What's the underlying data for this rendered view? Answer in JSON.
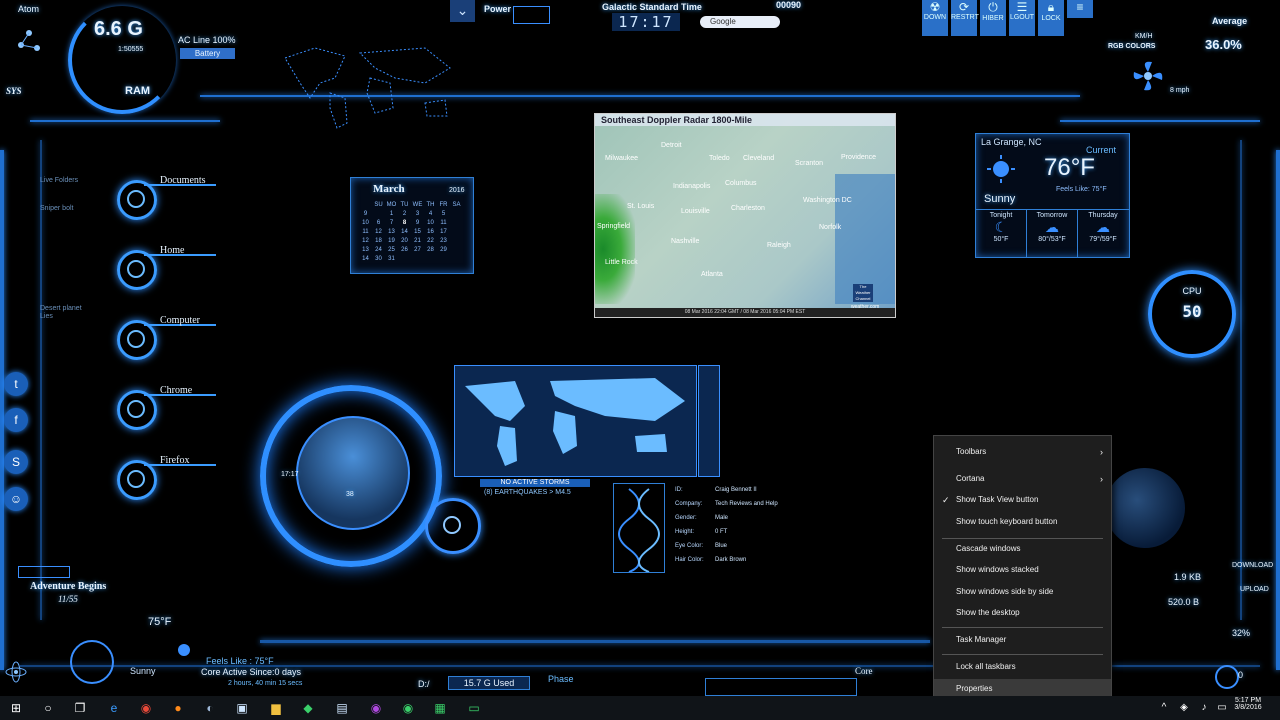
{
  "top_left": {
    "atom_label": "Atom",
    "ram_value": "6.6 G",
    "ram_sub": "1:50555",
    "ram_label": "RAM",
    "ac_line": "AC Line 100%",
    "battery": "Battery",
    "sys_label": "SYS"
  },
  "top_center": {
    "power_label": "Power",
    "clock_title": "Galactic Standard Time",
    "clock_value": "17:17",
    "search_label": "Google",
    "counter": "00090"
  },
  "top_buttons": [
    "DOWN",
    "RESTRT",
    "HIBER",
    "LGOUT",
    "LOCK"
  ],
  "top_right": {
    "average_label": "Average",
    "average_value": "36.0%",
    "kmh": "KM/H",
    "rgb": "RGB COLORS",
    "speed": "8 mph"
  },
  "shortcuts": [
    {
      "label": "Documents"
    },
    {
      "label": "Home"
    },
    {
      "label": "Computer"
    },
    {
      "label": "Chrome"
    },
    {
      "label": "Firefox"
    }
  ],
  "left_notes": [
    "Live Folders",
    "Sniper bolt",
    "Desert planet",
    "Lies"
  ],
  "calendar": {
    "month": "March",
    "year": "2016",
    "days": [
      "SU",
      "MO",
      "TU",
      "WE",
      "TH",
      "FR",
      "SA"
    ],
    "weeks": [
      [
        "9",
        "",
        "1",
        "2",
        "3",
        "4",
        "5"
      ],
      [
        "10",
        "6",
        "7",
        "8",
        "9",
        "10",
        "11"
      ],
      [
        "11",
        "12",
        "13",
        "14",
        "15",
        "16",
        "17"
      ],
      [
        "12",
        "18",
        "19",
        "20",
        "21",
        "22",
        "23"
      ],
      [
        "13",
        "24",
        "25",
        "26",
        "27",
        "28",
        "29"
      ],
      [
        "14",
        "30",
        "31",
        "",
        "",
        "",
        ""
      ]
    ]
  },
  "radar": {
    "title": "Southeast Doppler Radar  1800-Mile",
    "cities": [
      "Milwaukee",
      "Detroit",
      "Toledo",
      "Cleveland",
      "Scranton",
      "Providence",
      "Indianapolis",
      "Columbus",
      "St. Louis",
      "Louisville",
      "Charleston",
      "Washington DC",
      "Springfield",
      "Nashville",
      "Raleigh",
      "Norfolk",
      "Little Rock",
      "Atlanta"
    ],
    "footer": "08 Mar 2016 22:04 GMT / 08 Mar 2016 05:04 PM EST",
    "brand": "The Weather Channel",
    "brand_site": "weather.com"
  },
  "weather": {
    "location": "La Grange, NC",
    "current_label": "Current",
    "temp": "76°F",
    "feels": "Feels Like: 75°F",
    "condition": "Sunny",
    "forecast": [
      {
        "day": "Tonight",
        "temp": "50°F"
      },
      {
        "day": "Tomorrow",
        "temp": "80°/53°F"
      },
      {
        "day": "Thursday",
        "temp": "79°/59°F"
      }
    ]
  },
  "cpu": {
    "label": "CPU",
    "value": "50"
  },
  "hud": {
    "time": "17:17",
    "number": "38"
  },
  "world_map": {
    "storms": "NO ACTIVE STORMS",
    "quakes": "(8) EARTHQUAKES > M4.5"
  },
  "profile": {
    "rows": [
      {
        "key": "ID:",
        "value": "Craig Bennett II"
      },
      {
        "key": "Company:",
        "value": "Tech Reviews and Help"
      },
      {
        "key": "Gender:",
        "value": "Male"
      },
      {
        "key": "Height:",
        "value": "0 FT"
      },
      {
        "key": "Eye Color:",
        "value": "Blue"
      },
      {
        "key": "Hair Color:",
        "value": "Dark Brown"
      }
    ]
  },
  "bottom_left": {
    "adventure": "Adventure Begins",
    "date": "11/55",
    "temp": "75°F",
    "condition": "Sunny",
    "feels": "Feels Like : 75°F",
    "core": "Core Active Since:0 days",
    "uptime": "2 hours, 40 min 15 secs"
  },
  "bottom_center": {
    "drive": "D:/",
    "storage": "15.7 G Used",
    "phase": "Phase",
    "core": "Core"
  },
  "network": {
    "download_label": "DOWNLOAD",
    "upload_label": "UPLOAD",
    "download_value": "1.9 KB",
    "upload_value": "520.0 B",
    "percent": "32%",
    "zero": "0"
  },
  "context_menu": {
    "items": [
      {
        "label": "Toolbars",
        "arrow": "›"
      },
      {
        "label": "Cortana",
        "arrow": "›"
      },
      {
        "label": "Show Task View button",
        "check": "✓"
      },
      {
        "label": "Show touch keyboard button"
      },
      {
        "label": "Cascade windows"
      },
      {
        "label": "Show windows stacked"
      },
      {
        "label": "Show windows side by side"
      },
      {
        "label": "Show the desktop"
      },
      {
        "label": "Task Manager"
      },
      {
        "label": "Lock all taskbars"
      },
      {
        "label": "Properties"
      }
    ]
  },
  "taskbar": {
    "time": "5:17 PM",
    "date": "3/8/2016",
    "icons": [
      "windows-logo",
      "cortana",
      "task-view",
      "edge",
      "chrome",
      "firefox",
      "steam",
      "explorer",
      "store-bag",
      "photoshop",
      "generic-app",
      "calc",
      "app-a",
      "app-b"
    ]
  },
  "colors": {
    "accent": "#2f8fff",
    "frame": "#1f6fd0",
    "background": "#000000",
    "menu_bg": "#1e1e1e"
  }
}
